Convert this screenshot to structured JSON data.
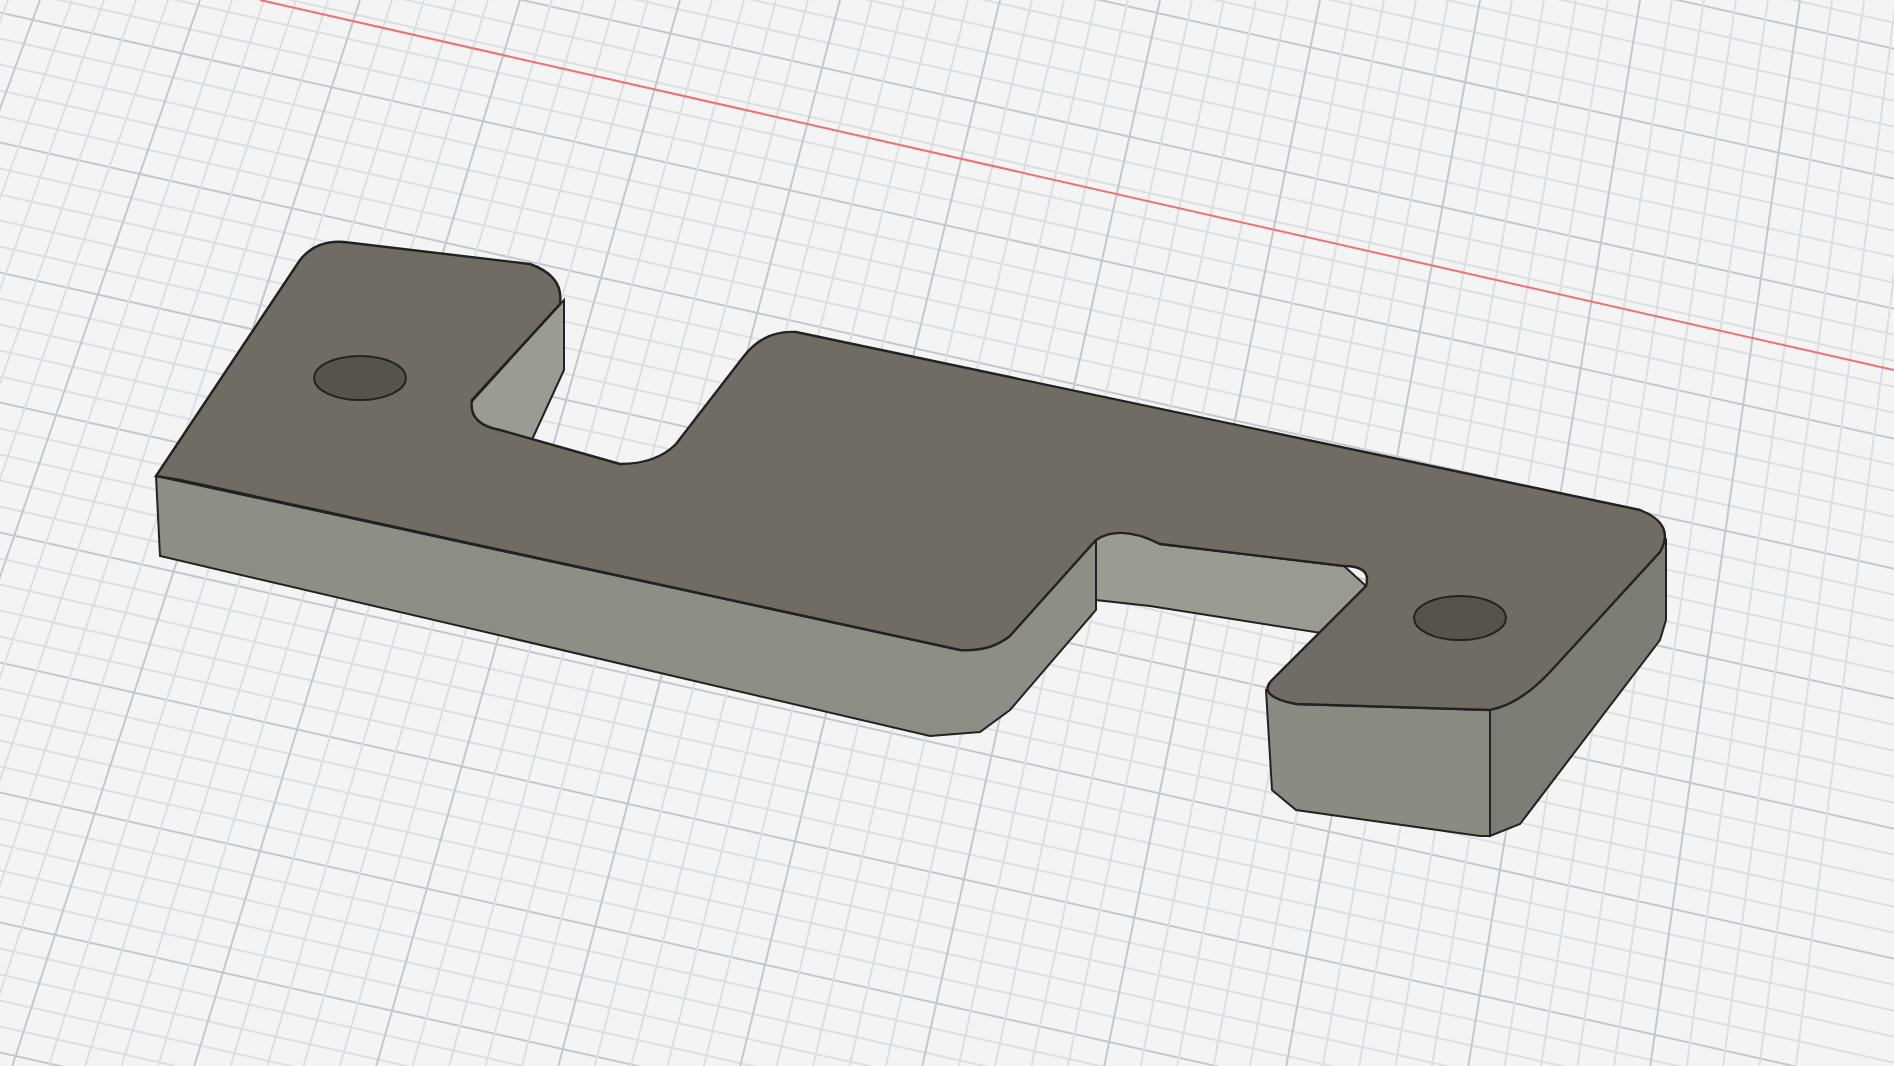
{
  "viewport": {
    "grid": true,
    "x_axis": true
  }
}
